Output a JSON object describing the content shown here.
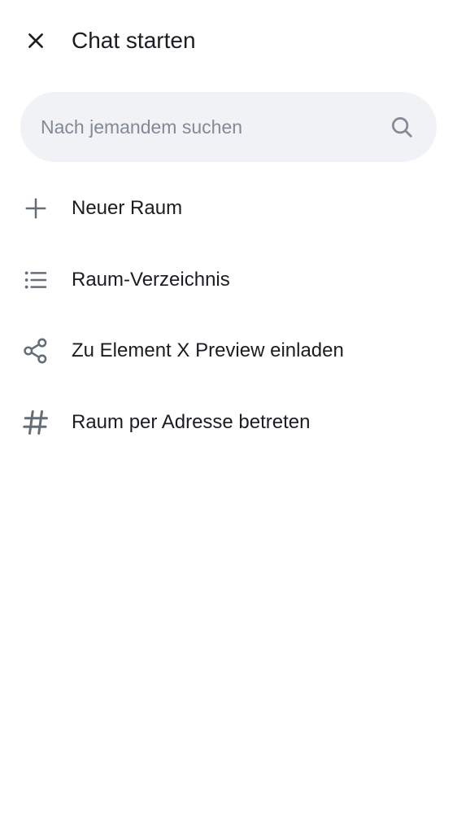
{
  "header": {
    "title": "Chat starten",
    "close_icon": "close-icon"
  },
  "search": {
    "placeholder": "Nach jemandem suchen",
    "value": "",
    "icon": "search-icon"
  },
  "menu": {
    "items": [
      {
        "label": "Neuer Raum",
        "icon": "plus-icon"
      },
      {
        "label": "Raum-Verzeichnis",
        "icon": "list-icon"
      },
      {
        "label": "Zu Element X Preview einladen",
        "icon": "share-icon"
      },
      {
        "label": "Raum per Adresse betreten",
        "icon": "hash-icon"
      }
    ]
  },
  "colors": {
    "text": "#1b1d22",
    "icon": "#656d77",
    "search_bg": "#f0f2f5",
    "placeholder": "#818a95",
    "background": "#ffffff"
  }
}
